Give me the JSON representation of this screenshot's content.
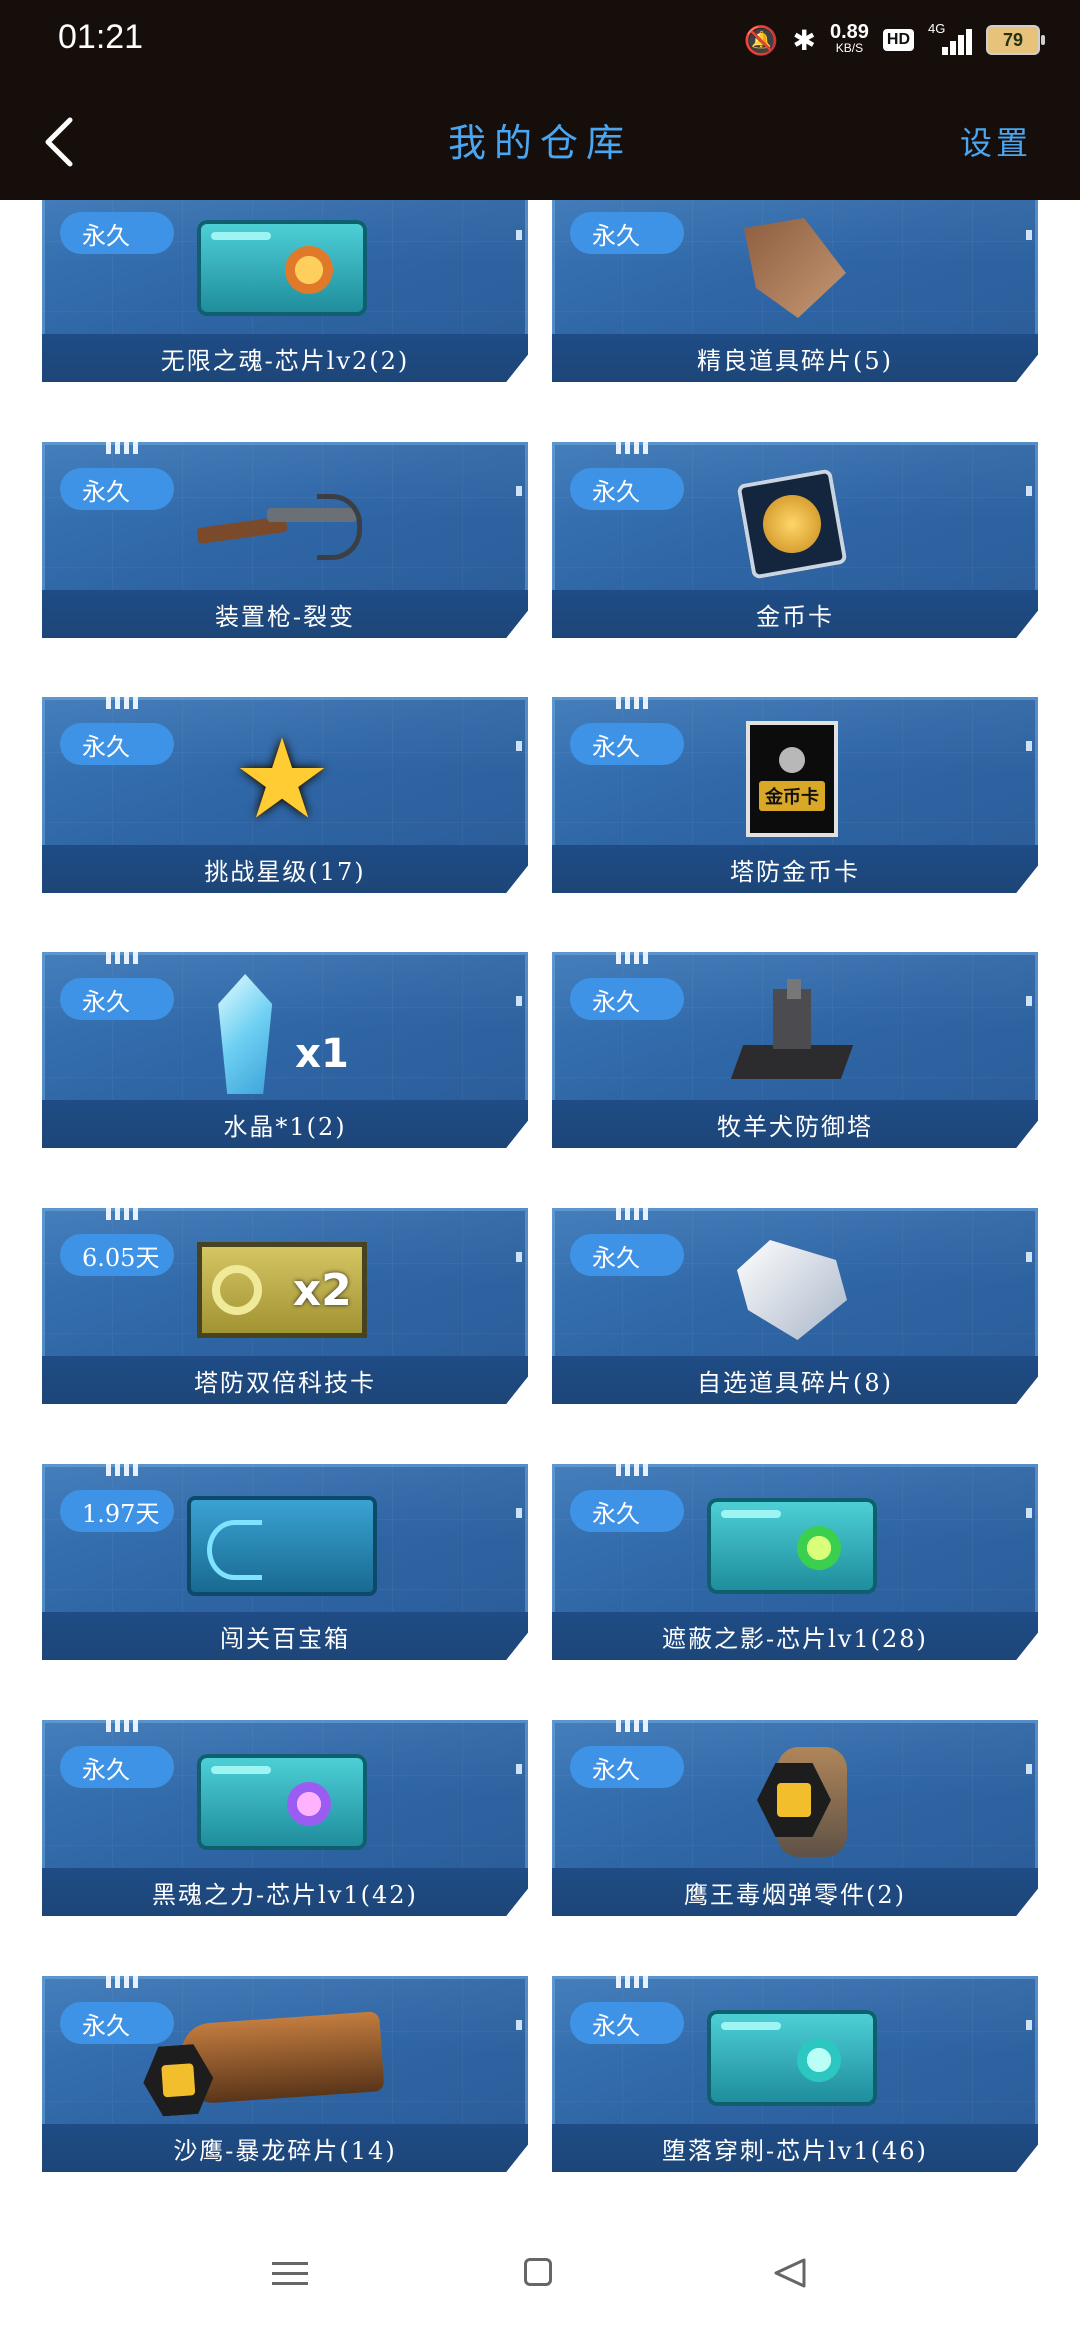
{
  "status": {
    "time": "01:21",
    "speed_value": "0.89",
    "speed_unit": "KB/S",
    "hd": "HD",
    "network": "4G",
    "battery": "79"
  },
  "header": {
    "title": "我的仓库",
    "settings_label": "设置"
  },
  "items": [
    {
      "badge": "永久",
      "name": "无限之魂-芯片lv2(2)"
    },
    {
      "badge": "永久",
      "name": "精良道具碎片(5)"
    },
    {
      "badge": "永久",
      "name": "装置枪-裂变"
    },
    {
      "badge": "永久",
      "name": "金币卡"
    },
    {
      "badge": "永久",
      "name": "挑战星级(17)"
    },
    {
      "badge": "永久",
      "name": "塔防金币卡"
    },
    {
      "badge": "永久",
      "name": "水晶*1(2)"
    },
    {
      "badge": "永久",
      "name": "牧羊犬防御塔"
    },
    {
      "badge": "6.05天",
      "name": "塔防双倍科技卡"
    },
    {
      "badge": "永久",
      "name": "自选道具碎片(8)"
    },
    {
      "badge": "1.97天",
      "name": "闯关百宝箱"
    },
    {
      "badge": "永久",
      "name": "遮蔽之影-芯片lv1(28)"
    },
    {
      "badge": "永久",
      "name": "黑魂之力-芯片lv1(42)"
    },
    {
      "badge": "永久",
      "name": "鹰王毒烟弹零件(2)"
    },
    {
      "badge": "永久",
      "name": "沙鹰-暴龙碎片(14)"
    },
    {
      "badge": "永久",
      "name": "堕落穿刺-芯片lv1(46)"
    }
  ],
  "art_labels": {
    "crystal_qty": "x1",
    "tech_card_multiplier": "x2",
    "gold_card_text": "金币卡"
  },
  "colors": {
    "accent": "#4aa6f0",
    "card_bg": "#2f66a6",
    "badge": "#3f93e6",
    "header_bg": "#160e0b"
  }
}
